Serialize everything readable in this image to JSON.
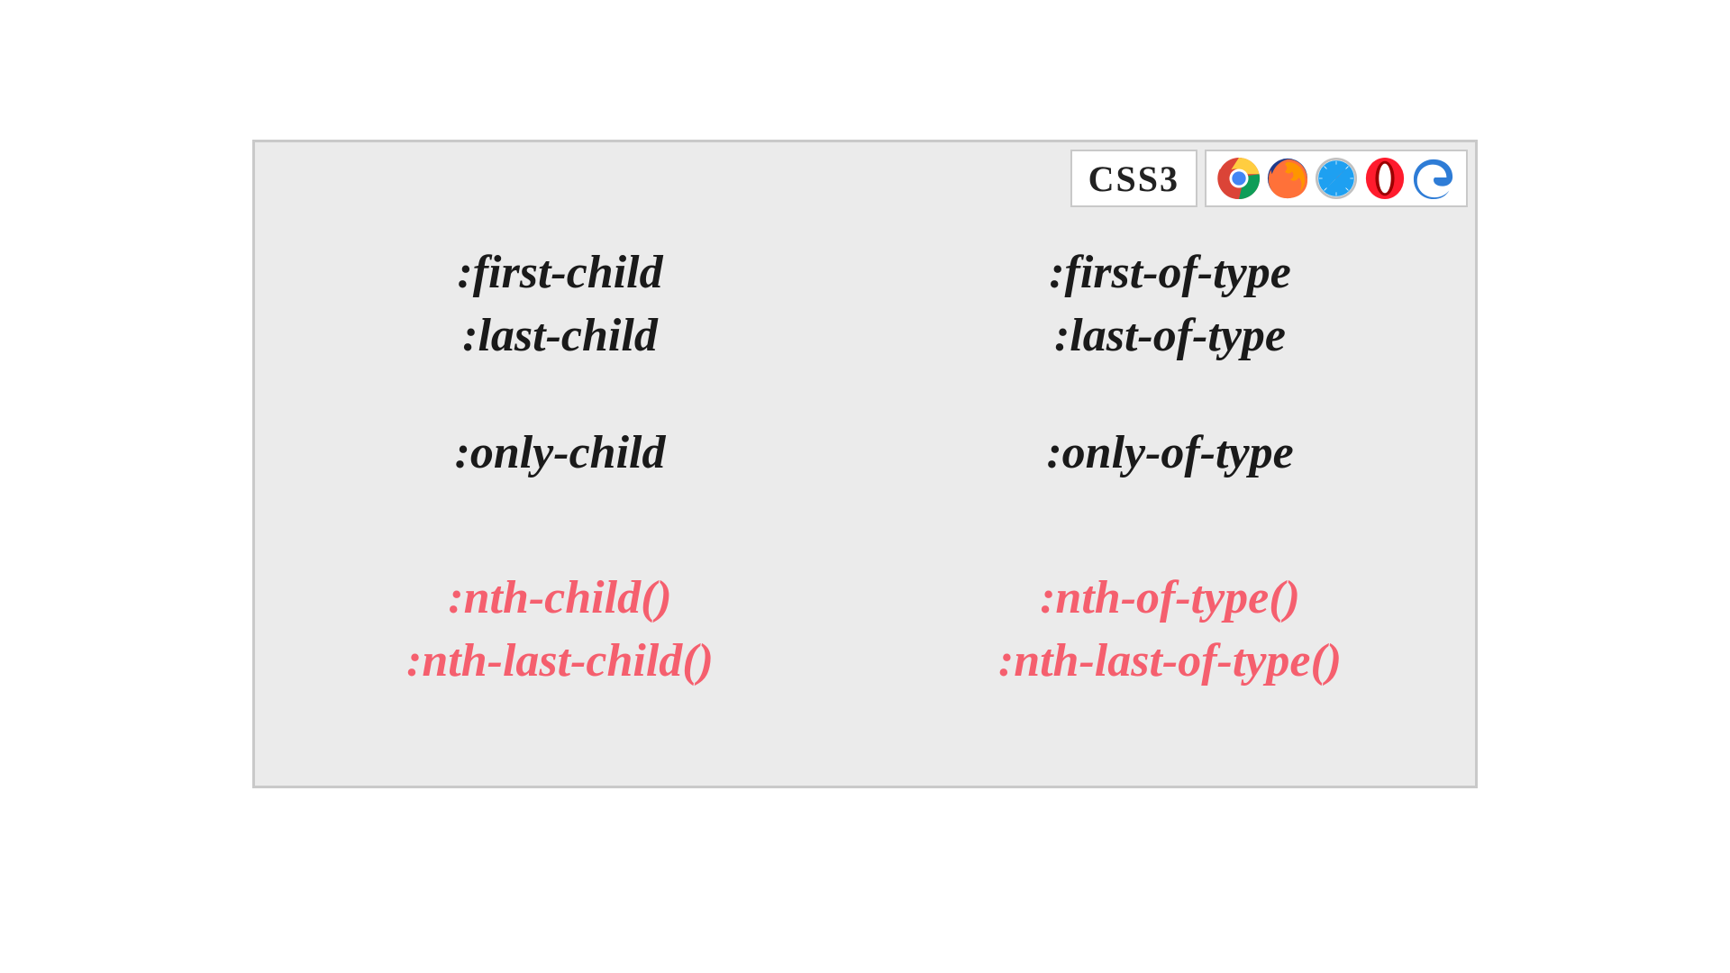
{
  "header": {
    "css3_label": "CSS3",
    "browser_icons": [
      "chrome-icon",
      "firefox-icon",
      "safari-icon",
      "opera-icon",
      "edge-icon"
    ]
  },
  "columns": {
    "left": {
      "groups": [
        {
          "highlight": false,
          "lines": [
            ":first-child",
            ":last-child"
          ]
        },
        {
          "highlight": false,
          "lines": [
            ":only-child"
          ]
        },
        {
          "highlight": true,
          "lines": [
            ":nth-child()",
            ":nth-last-child()"
          ]
        }
      ]
    },
    "right": {
      "groups": [
        {
          "highlight": false,
          "lines": [
            ":first-of-type",
            ":last-of-type"
          ]
        },
        {
          "highlight": false,
          "lines": [
            ":only-of-type"
          ]
        },
        {
          "highlight": true,
          "lines": [
            ":nth-of-type()",
            ":nth-last-of-type()"
          ]
        }
      ]
    }
  },
  "colors": {
    "panel_bg": "#ebebeb",
    "panel_border": "#c9c9c9",
    "text": "#1a1a1a",
    "highlight": "#f55f6e"
  }
}
